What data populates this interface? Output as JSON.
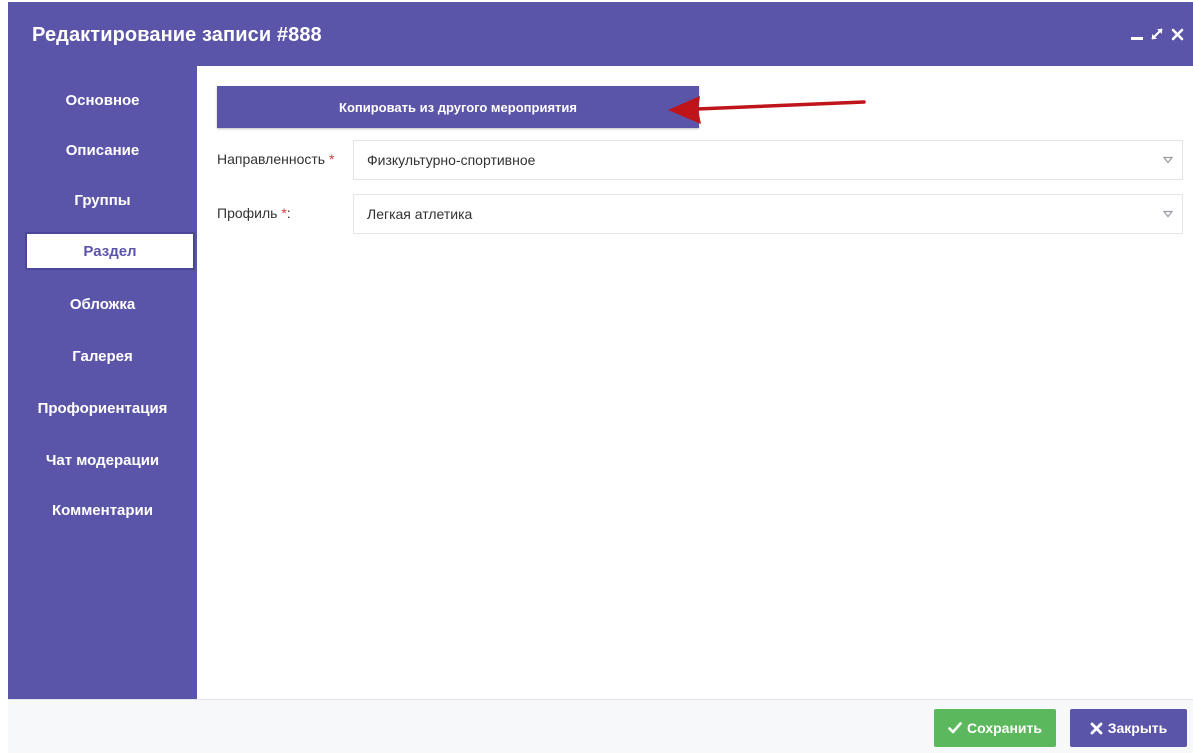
{
  "window": {
    "title": "Редактирование записи #888",
    "controls": {
      "minimize": "minimize-icon",
      "maximize": "maximize-icon",
      "close": "close-icon"
    }
  },
  "sidebar": {
    "items": [
      {
        "label": "Основное",
        "active": false
      },
      {
        "label": "Описание",
        "active": false
      },
      {
        "label": "Группы",
        "active": false
      },
      {
        "label": "Раздел",
        "active": true
      },
      {
        "label": "Обложка",
        "active": false
      },
      {
        "label": "Галерея",
        "active": false
      },
      {
        "label": "Профориентация",
        "active": false
      },
      {
        "label": "Чат модерации",
        "active": false
      },
      {
        "label": "Комментарии",
        "active": false
      }
    ]
  },
  "main": {
    "copy_button": "Копировать из другого мероприятия",
    "fields": {
      "direction": {
        "label": "Направленность",
        "required_mark": "*",
        "value": "Физкультурно-спортивное"
      },
      "profile": {
        "label": "Профиль",
        "required_mark": "*",
        "suffix": ":",
        "value": "Легкая атлетика"
      }
    }
  },
  "footer": {
    "save_label": "Сохранить",
    "close_label": "Закрыть"
  },
  "colors": {
    "accent": "#5a55a8",
    "save": "#5cb85c",
    "required": "#d23c3c",
    "annotation_arrow": "#c0141b"
  }
}
